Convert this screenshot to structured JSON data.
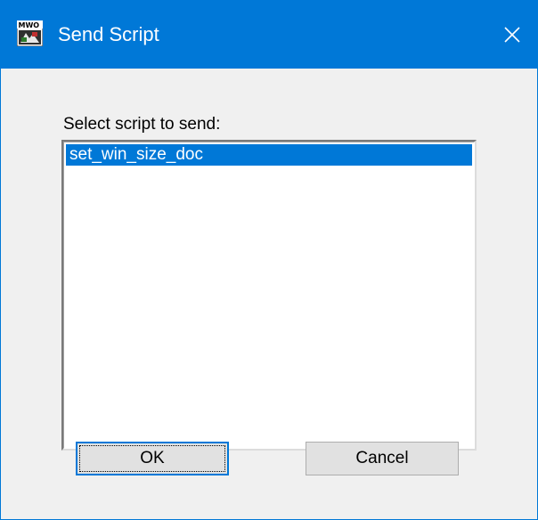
{
  "window": {
    "title": "Send Script",
    "icon": "mwo-app-icon",
    "close_icon": "close-icon"
  },
  "dialog": {
    "list_label": "Select script to send:",
    "scripts": [
      {
        "name": "set_win_size_doc",
        "selected": true
      }
    ],
    "ok_label": "OK",
    "cancel_label": "Cancel"
  },
  "colors": {
    "accent": "#0078d7",
    "dialog_bg": "#f0f0f0",
    "button_bg": "#e1e1e1"
  }
}
